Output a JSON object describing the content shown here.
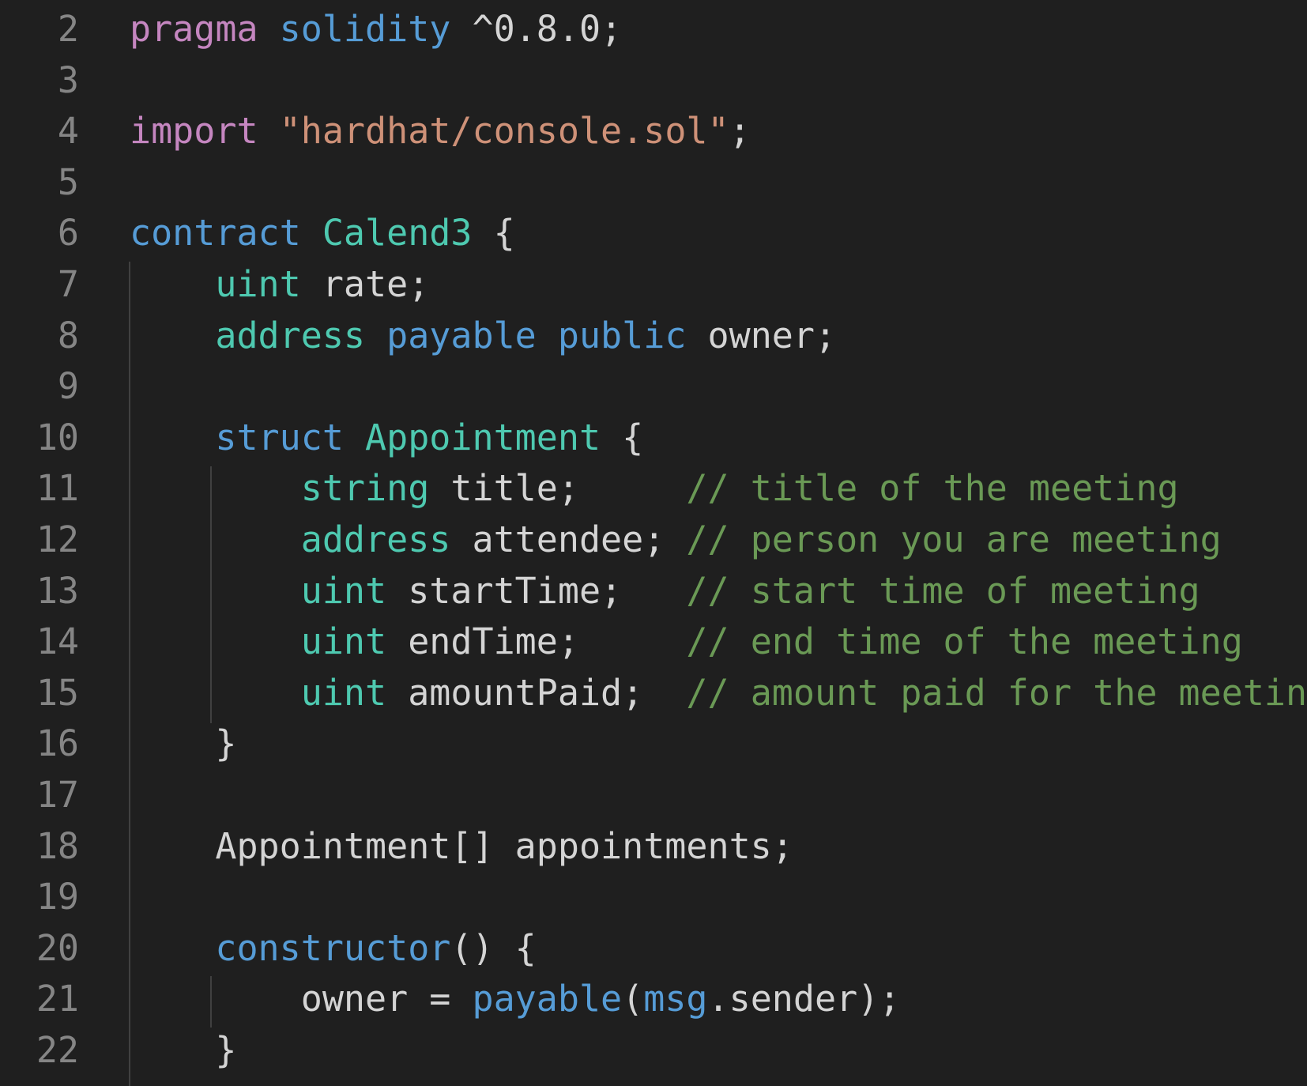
{
  "editor": {
    "lines": [
      {
        "num": "2",
        "tokens": [
          [
            "kw-p",
            "pragma"
          ],
          [
            "id",
            " "
          ],
          [
            "kw-b",
            "solidity"
          ],
          [
            "id",
            " ^0.8.0;"
          ]
        ]
      },
      {
        "num": "3",
        "tokens": []
      },
      {
        "num": "4",
        "tokens": [
          [
            "kw-p",
            "import"
          ],
          [
            "id",
            " "
          ],
          [
            "str",
            "\"hardhat/console.sol\""
          ],
          [
            "id",
            ";"
          ]
        ]
      },
      {
        "num": "5",
        "tokens": []
      },
      {
        "num": "6",
        "tokens": [
          [
            "kw-b",
            "contract"
          ],
          [
            "id",
            " "
          ],
          [
            "ty",
            "Calend3"
          ],
          [
            "id",
            " {"
          ]
        ]
      },
      {
        "num": "7",
        "tokens": [
          [
            "id",
            "    "
          ],
          [
            "ty",
            "uint"
          ],
          [
            "id",
            " rate;"
          ]
        ]
      },
      {
        "num": "8",
        "tokens": [
          [
            "id",
            "    "
          ],
          [
            "ty",
            "address"
          ],
          [
            "id",
            " "
          ],
          [
            "kw-b",
            "payable"
          ],
          [
            "id",
            " "
          ],
          [
            "kw-b",
            "public"
          ],
          [
            "id",
            " owner;"
          ]
        ]
      },
      {
        "num": "9",
        "tokens": []
      },
      {
        "num": "10",
        "tokens": [
          [
            "id",
            "    "
          ],
          [
            "kw-b",
            "struct"
          ],
          [
            "id",
            " "
          ],
          [
            "ty",
            "Appointment"
          ],
          [
            "id",
            " {"
          ]
        ]
      },
      {
        "num": "11",
        "tokens": [
          [
            "id",
            "        "
          ],
          [
            "ty",
            "string"
          ],
          [
            "id",
            " title;     "
          ],
          [
            "cm",
            "// title of the meeting"
          ]
        ]
      },
      {
        "num": "12",
        "tokens": [
          [
            "id",
            "        "
          ],
          [
            "ty",
            "address"
          ],
          [
            "id",
            " attendee; "
          ],
          [
            "cm",
            "// person you are meeting"
          ]
        ]
      },
      {
        "num": "13",
        "tokens": [
          [
            "id",
            "        "
          ],
          [
            "ty",
            "uint"
          ],
          [
            "id",
            " startTime;   "
          ],
          [
            "cm",
            "// start time of meeting"
          ]
        ]
      },
      {
        "num": "14",
        "tokens": [
          [
            "id",
            "        "
          ],
          [
            "ty",
            "uint"
          ],
          [
            "id",
            " endTime;     "
          ],
          [
            "cm",
            "// end time of the meeting"
          ]
        ]
      },
      {
        "num": "15",
        "tokens": [
          [
            "id",
            "        "
          ],
          [
            "ty",
            "uint"
          ],
          [
            "id",
            " amountPaid;  "
          ],
          [
            "cm",
            "// amount paid for the meeting"
          ]
        ]
      },
      {
        "num": "16",
        "tokens": [
          [
            "id",
            "    }"
          ]
        ]
      },
      {
        "num": "17",
        "tokens": []
      },
      {
        "num": "18",
        "tokens": [
          [
            "id",
            "    Appointment[] appointments;"
          ]
        ]
      },
      {
        "num": "19",
        "tokens": []
      },
      {
        "num": "20",
        "tokens": [
          [
            "id",
            "    "
          ],
          [
            "fn",
            "constructor"
          ],
          [
            "id",
            "() {"
          ]
        ]
      },
      {
        "num": "21",
        "tokens": [
          [
            "id",
            "        owner = "
          ],
          [
            "fn",
            "payable"
          ],
          [
            "id",
            "("
          ],
          [
            "var",
            "msg"
          ],
          [
            "id",
            ".sender);"
          ]
        ]
      },
      {
        "num": "22",
        "tokens": [
          [
            "id",
            "    }"
          ]
        ]
      }
    ]
  },
  "colors": {
    "background": "#1f1f1f",
    "line_number": "#858585",
    "keyword_purple": "#c586c0",
    "keyword_blue": "#569cd6",
    "type_teal": "#4ec9b0",
    "string": "#ce9178",
    "comment": "#6a9955",
    "text": "#d4d4d4"
  }
}
